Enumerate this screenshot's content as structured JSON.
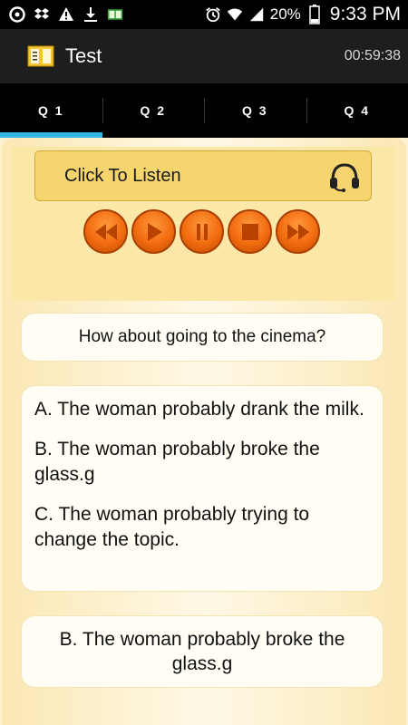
{
  "status_bar": {
    "left_icons": [
      "notification-icon",
      "dropbox-icon",
      "warning-icon",
      "download-icon",
      "book-icon"
    ],
    "right_icons": [
      "alarm-icon",
      "wifi-icon",
      "signal-icon",
      "battery-icon"
    ],
    "battery": "20%",
    "time": "9:33 PM"
  },
  "app_bar": {
    "icon": "book-icon",
    "title": "Test",
    "timer": "00:59:38"
  },
  "tabs": [
    {
      "label": "Q 1",
      "active": true
    },
    {
      "label": "Q 2",
      "active": false
    },
    {
      "label": "Q 3",
      "active": false
    },
    {
      "label": "Q 4",
      "active": false
    }
  ],
  "listen": {
    "label": "Click To Listen",
    "icon": "headphones-icon"
  },
  "player_controls": [
    "rewind-icon",
    "play-icon",
    "pause-icon",
    "stop-icon",
    "fast-forward-icon"
  ],
  "question": "How about going to the cinema?",
  "options": [
    "A. The woman probably drank the milk.",
    "B. The woman probably broke the glass.g",
    "C. The woman probably trying to change the topic."
  ],
  "answer": "B. The woman probably broke the glass.g",
  "colors": {
    "accent": "#33b5e5",
    "button_orange": "#f26b0f",
    "listen_button": "#f6d56e",
    "background": "#fdf2cf"
  }
}
